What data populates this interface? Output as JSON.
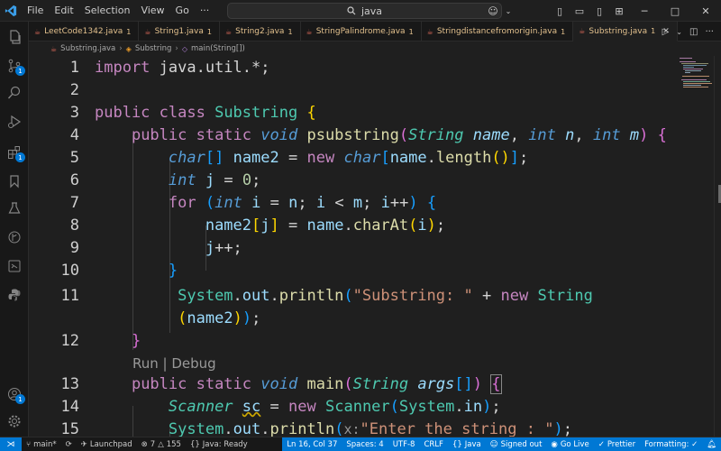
{
  "menu": [
    "File",
    "Edit",
    "Selection",
    "View",
    "Go"
  ],
  "search": {
    "text": "java"
  },
  "tabs": [
    {
      "label": "LeetCode1342.java",
      "count": "1"
    },
    {
      "label": "String1.java",
      "count": "1"
    },
    {
      "label": "String2.java",
      "count": "1"
    },
    {
      "label": "StringPalindrome.java",
      "count": "1"
    },
    {
      "label": "Stringdistancefromorigin.java",
      "count": "1"
    },
    {
      "label": "Substring.java",
      "count": "1"
    }
  ],
  "breadcrumb": {
    "file": "Substring.java",
    "class": "Substring",
    "method": "main(String[])"
  },
  "line_numbers": [
    "1",
    "2",
    "3",
    "4",
    "5",
    "6",
    "7",
    "8",
    "9",
    "10",
    "11",
    "",
    "12",
    "",
    "13",
    "14",
    "15"
  ],
  "code_lens": "Run | Debug",
  "code": {
    "l1a": "import",
    "l1b": " java.util.*;",
    "l3a": "public class",
    "l3b": "Substring",
    "l4_kw": "public static",
    "l4_void": "void",
    "l4_fn": "psubstring",
    "l4_type": "String",
    "l4_p1": "name",
    "l4_int1": "int",
    "l4_p2": "n",
    "l4_int2": "int",
    "l4_p3": "m",
    "l5_type": "char",
    "l5_var": "name2",
    "l5_new": "new",
    "l5_type2": "char",
    "l5_name": "name",
    "l5_len": "length",
    "l6_type": "int",
    "l6_var": "j",
    "l6_num": "0",
    "l7_for": "for",
    "l7_int": "int",
    "l7_i": "i",
    "l7_n": "n",
    "l7_i2": "i",
    "l7_m": "m",
    "l7_i3": "i",
    "l8_var": "name2",
    "l8_j": "j",
    "l8_name": "name",
    "l8_fn": "charAt",
    "l8_i": "i",
    "l9_j": "j",
    "l11_sys": "System",
    "l11_out": "out",
    "l11_fn": "println",
    "l11_str": "\"Substring: \"",
    "l11_new": "new",
    "l11_type": "String",
    "l11b_var": "name2",
    "l13_kw": "public static",
    "l13_void": "void",
    "l13_fn": "main",
    "l13_type": "String",
    "l13_p": "args",
    "l14_type": "Scanner",
    "l14_var": "sc",
    "l14_new": "new",
    "l14_type2": "Scanner",
    "l14_sys": "System",
    "l14_in": "in",
    "l15_sys": "System",
    "l15_out": "out",
    "l15_fn": "println",
    "l15_hint": "x:",
    "l15_str": "\"Enter the string : \""
  },
  "status": {
    "branch": "main*",
    "launchpad": "Launchpad",
    "errors": "7",
    "warnings": "155",
    "java": "Java: Ready",
    "position": "Ln 16, Col 37",
    "spaces": "Spaces: 4",
    "encoding": "UTF-8",
    "eol": "CRLF",
    "language": "Java",
    "account": "Signed out",
    "golive": "Go Live",
    "prettier": "Prettier",
    "formatting": "Formatting: ✓"
  },
  "colors": {
    "accent": "#0078d4",
    "background": "#1f1f1f",
    "tab_text": "#e2c08d"
  }
}
